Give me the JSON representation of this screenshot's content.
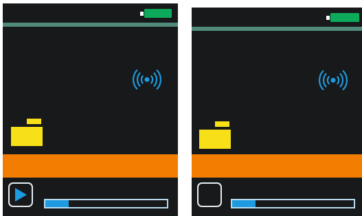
{
  "colors": {
    "screen_background": "#17191a",
    "battery": "#0eaa5c",
    "divider": "#4f8a7a",
    "signal": "#1e9ae0",
    "folder": "#f7e018",
    "status_bar": "#f27d00",
    "play_icon": "#1e9ae0",
    "progress_fill": "#1e9ae0"
  },
  "screens": [
    {
      "battery_level": 1.0,
      "icons": [
        "battery-icon",
        "wireless-signal-icon",
        "folder-icon",
        "play-icon"
      ],
      "play_button": {
        "icon": "play-icon",
        "visible": true
      },
      "progress_fraction": 0.19
    },
    {
      "battery_level": 1.0,
      "icons": [
        "battery-icon",
        "wireless-signal-icon",
        "folder-icon"
      ],
      "play_button": {
        "icon": "",
        "visible": false
      },
      "progress_fraction": 0.19
    }
  ]
}
